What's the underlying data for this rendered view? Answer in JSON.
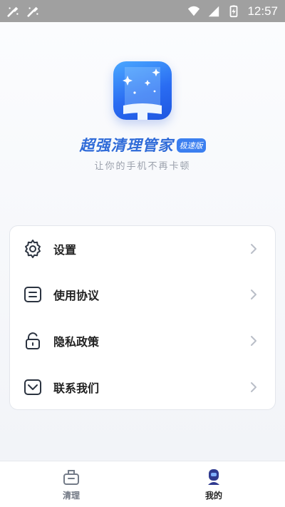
{
  "status_bar": {
    "time": "12:57",
    "icons": [
      "cleaner-notification-icon",
      "cleaner-notification-icon",
      "wifi-icon",
      "signal-icon",
      "battery-icon"
    ]
  },
  "app": {
    "name": "超强清理管家",
    "badge": "极速版",
    "slogan": "让你的手机不再卡顿"
  },
  "menu": {
    "items": [
      {
        "label": "设置",
        "icon": "gear-icon"
      },
      {
        "label": "使用协议",
        "icon": "document-icon"
      },
      {
        "label": "隐私政策",
        "icon": "lock-icon"
      },
      {
        "label": "联系我们",
        "icon": "mail-icon"
      }
    ]
  },
  "tabbar": {
    "tabs": [
      {
        "label": "清理",
        "icon": "clean-icon",
        "active": false
      },
      {
        "label": "我的",
        "icon": "profile-icon",
        "active": true
      }
    ]
  },
  "colors": {
    "brand": "#2f6bd8",
    "badge": "#3b7ff0",
    "status_bar": "#a0a0a0"
  }
}
